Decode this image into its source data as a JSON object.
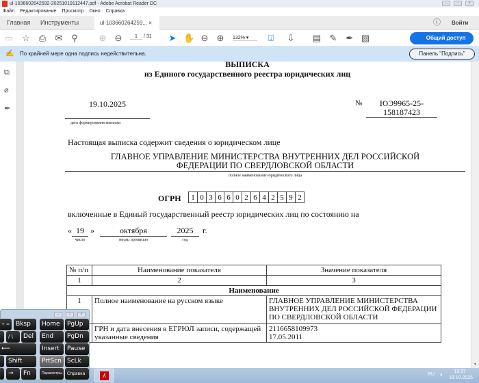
{
  "window": {
    "title": "ul-1036602642592-20251019112447.pdf - Adobe Acrobat Reader DC"
  },
  "menu": [
    "Файл",
    "Редактирование",
    "Просмотр",
    "Окно",
    "Справка"
  ],
  "tabs": {
    "home": "Главная",
    "tools": "Инструменты",
    "doc": "ul-103660264259...",
    "close": "×",
    "signin": "Войти"
  },
  "toolbar": {
    "page_current": "1",
    "page_total": "/ 31",
    "zoom": "132%",
    "share": "Общий доступ"
  },
  "notice": {
    "text": "По крайней мере одна подпись недействительна.",
    "panel_button": "Панель \"Подпись\""
  },
  "document": {
    "title": "ВЫПИСКА",
    "subtitle": "из Единого государственного реестра юридических лиц",
    "date": "19.10.2025",
    "date_caption": "дата формирования выписки",
    "number_sign": "№",
    "number_line1": "ЮЭ9965-25-",
    "number_line2": "158187423",
    "intro": "Настоящая выписка содержит сведения о юридическом лице",
    "entity_line1": "ГЛАВНОЕ УПРАВЛЕНИЕ МИНИСТЕРСТВА ВНУТРЕННИХ ДЕЛ РОССИЙСКОЙ",
    "entity_line2": "ФЕДЕРАЦИИ ПО СВЕРДЛОВСКОЙ ОБЛАСТИ",
    "entity_caption": "полное наименование юридического лица",
    "ogrn_label": "ОГРН",
    "ogrn_digits": [
      "1",
      "0",
      "3",
      "6",
      "6",
      "0",
      "2",
      "6",
      "4",
      "2",
      "5",
      "9",
      "2"
    ],
    "included": "включенные в Единый государственный реестр юридических лиц по состоянию на",
    "q_open": "«",
    "day": "19",
    "q_close": "»",
    "month": "октября",
    "year": "2025",
    "year_suffix": "г.",
    "day_caption": "число",
    "month_caption": "месяц прописью",
    "year_caption": "год",
    "table": {
      "headers": [
        "№ п/п",
        "Наименование показателя",
        "Значение показателя"
      ],
      "numbers": [
        "1",
        "2",
        "3"
      ],
      "section": "Наименование",
      "rows": [
        {
          "n": "1",
          "name": "Полное наименование на русском языке",
          "value": "ГЛАВНОЕ УПРАВЛЕНИЕ МИНИСТЕРСТВА ВНУТРЕННИХ ДЕЛ РОССИЙСКОЙ ФЕДЕРАЦИИ ПО СВЕРДЛОВСКОЙ ОБЛАСТИ"
        },
        {
          "n": "",
          "name": "ГРН и дата внесения в ЕГРЮЛ записи, содержащей указанные сведения",
          "value_line1": "2116658109973",
          "value_line2": "17.05.2011"
        }
      ]
    }
  },
  "keyboard": {
    "keys": [
      "Bksp",
      "Home",
      "PgUp",
      "Del",
      "End",
      "PgDn",
      "Insert",
      "Pause",
      "Shift",
      "PrtScn",
      "ScLk",
      "Fn",
      "Параметры",
      "Справка"
    ]
  },
  "taskbar": {
    "lang": "RU",
    "time": "13:37",
    "date": "19.10.2025"
  }
}
